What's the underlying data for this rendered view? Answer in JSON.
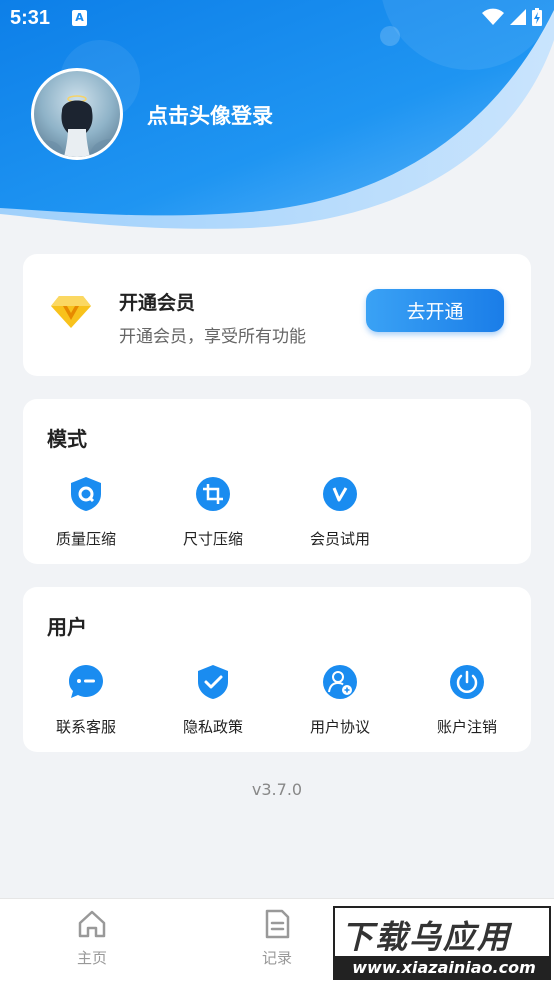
{
  "status_bar": {
    "time": "5:31",
    "app_badge": "A"
  },
  "profile": {
    "login_prompt": "点击头像登录"
  },
  "vip": {
    "title": "开通会员",
    "subtitle": "开通会员，享受所有功能",
    "button_label": "去开通"
  },
  "mode": {
    "title": "模式",
    "items": [
      {
        "label": "质量压缩",
        "icon": "shield-q-icon"
      },
      {
        "label": "尺寸压缩",
        "icon": "crop-icon"
      },
      {
        "label": "会员试用",
        "icon": "vip-v-icon"
      }
    ]
  },
  "user": {
    "title": "用户",
    "items": [
      {
        "label": "联系客服",
        "icon": "chat-icon"
      },
      {
        "label": "隐私政策",
        "icon": "shield-check-icon"
      },
      {
        "label": "用户协议",
        "icon": "user-agreement-icon"
      },
      {
        "label": "账户注销",
        "icon": "power-icon"
      }
    ]
  },
  "version": "v3.7.0",
  "bottom_nav": {
    "items": [
      {
        "label": "主页",
        "icon": "home-icon"
      },
      {
        "label": "记录",
        "icon": "document-icon"
      }
    ]
  },
  "watermark": {
    "top": "下载乌应用",
    "bottom": "www.xiazainiao.com"
  },
  "colors": {
    "primary": "#1a8cf0",
    "accent_gold": "#f5b400",
    "background": "#f1f3f6"
  }
}
